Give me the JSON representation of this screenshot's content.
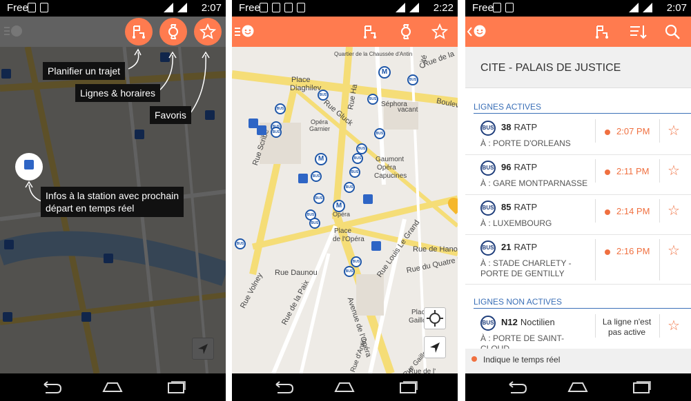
{
  "status": {
    "carrier": "Free",
    "time_left": "2:07",
    "time_middle": "2:22",
    "time_right": "2:07"
  },
  "panel1": {
    "callouts": {
      "plan": "Planifier un trajet",
      "lines": "Lignes & horaires",
      "favorites": "Favoris",
      "station_line1": "Infos à la station avec prochain",
      "station_line2": "départ en temps réel"
    },
    "icons": [
      "route-flag-icon",
      "watch-icon",
      "star-icon",
      "location-arrow-icon"
    ]
  },
  "panel2": {
    "map_labels": {
      "quartier": "Quartier de la Chaussée d'Antin",
      "place_diaghilev_1": "Place",
      "place_diaghilev_2": "Diaghilev",
      "rue_gluck": "Rue Gluck",
      "opera_garnier_1": "Opéra",
      "opera_garnier_2": "Garnier",
      "sephora": "Séphora",
      "vacant": "vacant",
      "gaumont_1": "Gaumont",
      "gaumont_2": "Opéra",
      "gaumont_3": "Capucines",
      "opera_1": "Opéra",
      "place_opera_1": "Place",
      "place_opera_2": "de l'Opéra",
      "rue_scribe": "Rue Scribe",
      "rue_daunou": "Rue Daunou",
      "rue_paix": "Rue de la Paix",
      "rue_volney": "Rue Volney",
      "avenue_opera": "Avenue de l'Opéra",
      "rue_louis_le_grand": "Rue Louis Le Grand",
      "rue_quatre_sept": "Rue du Quatre Se",
      "rue_hanovre": "Rue de Hano",
      "rue_de_la": "Rue de la",
      "boulev": "Boulev",
      "rue_ha": "Rue Ha",
      "cite": "Cité",
      "rue_antin": "Rue d'Antin",
      "rue_gaillon": "Rue Gaillon",
      "place_gaillon_1": "Place",
      "place_gaillon_2": "Gaillon",
      "rue_de_l": "Rue de l'"
    }
  },
  "panel3": {
    "station_title": "CITE - PALAIS DE JUSTICE",
    "active_header": "LIGNES ACTIVES",
    "inactive_header": "LIGNES NON ACTIVES",
    "bus_badge": "BUS",
    "active_lines": [
      {
        "number": "38",
        "operator": "RATP",
        "direction": "À : PORTE D'ORLEANS",
        "time": "2:07 PM"
      },
      {
        "number": "96",
        "operator": "RATP",
        "direction": "À : GARE MONTPARNASSE",
        "time": "2:11 PM"
      },
      {
        "number": "85",
        "operator": "RATP",
        "direction": "À : LUXEMBOURG",
        "time": "2:14 PM"
      },
      {
        "number": "21",
        "operator": "RATP",
        "direction": "À : STADE CHARLETY - PORTE DE GENTILLY",
        "time": "2:16 PM"
      }
    ],
    "inactive_lines": [
      {
        "number": "N12",
        "operator": "Noctilien",
        "direction": "À : PORTE DE SAINT-CLOUD",
        "status": "La ligne n'est pas active"
      }
    ],
    "legend": "Indique le temps réel"
  },
  "colors": {
    "accent": "#ff7b4f",
    "realtime": "#f07040",
    "link_blue": "#3a6fb7",
    "bus_blue": "#1e3d7b"
  }
}
